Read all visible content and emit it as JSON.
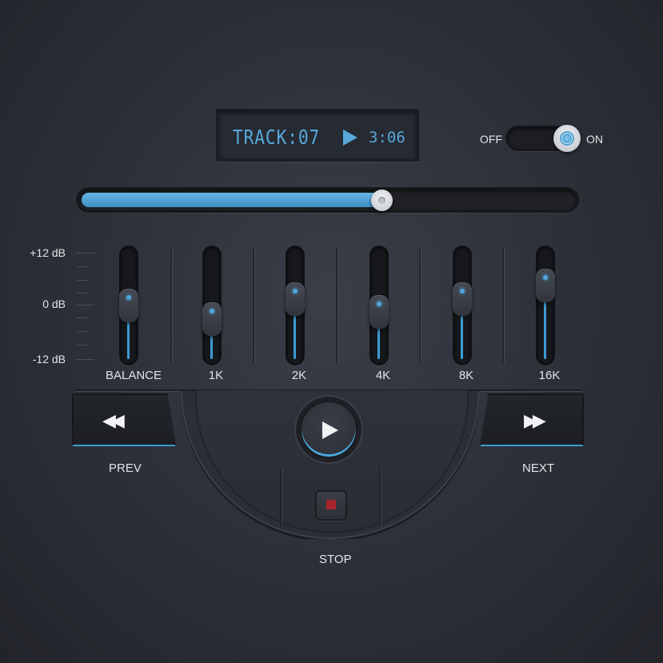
{
  "display": {
    "track": "TRACK:07",
    "time": "3:06",
    "status_icon": "play-icon"
  },
  "power_toggle": {
    "off_label": "OFF",
    "on_label": "ON",
    "state": "on"
  },
  "progress": {
    "fraction": 0.61
  },
  "equalizer": {
    "db_labels": {
      "top": "+12 dB",
      "middle": "0 dB",
      "bottom": "-12 dB"
    },
    "range_db": [
      -12,
      12
    ],
    "sliders": [
      {
        "label": "BALANCE",
        "value_db": 0
      },
      {
        "label": "1K",
        "value_db": -4
      },
      {
        "label": "2K",
        "value_db": 2
      },
      {
        "label": "4K",
        "value_db": -2
      },
      {
        "label": "8K",
        "value_db": 2
      },
      {
        "label": "16K",
        "value_db": 6
      }
    ]
  },
  "controls": {
    "prev_label": "PREV",
    "next_label": "NEXT",
    "stop_label": "STOP",
    "prev_icon": "rewind-icon",
    "next_icon": "fast-forward-icon",
    "play_icon": "play-icon",
    "stop_icon": "stop-icon"
  },
  "colors": {
    "accent": "#4aa3d6",
    "stop": "#a7242c",
    "background": "#2c2f37"
  }
}
